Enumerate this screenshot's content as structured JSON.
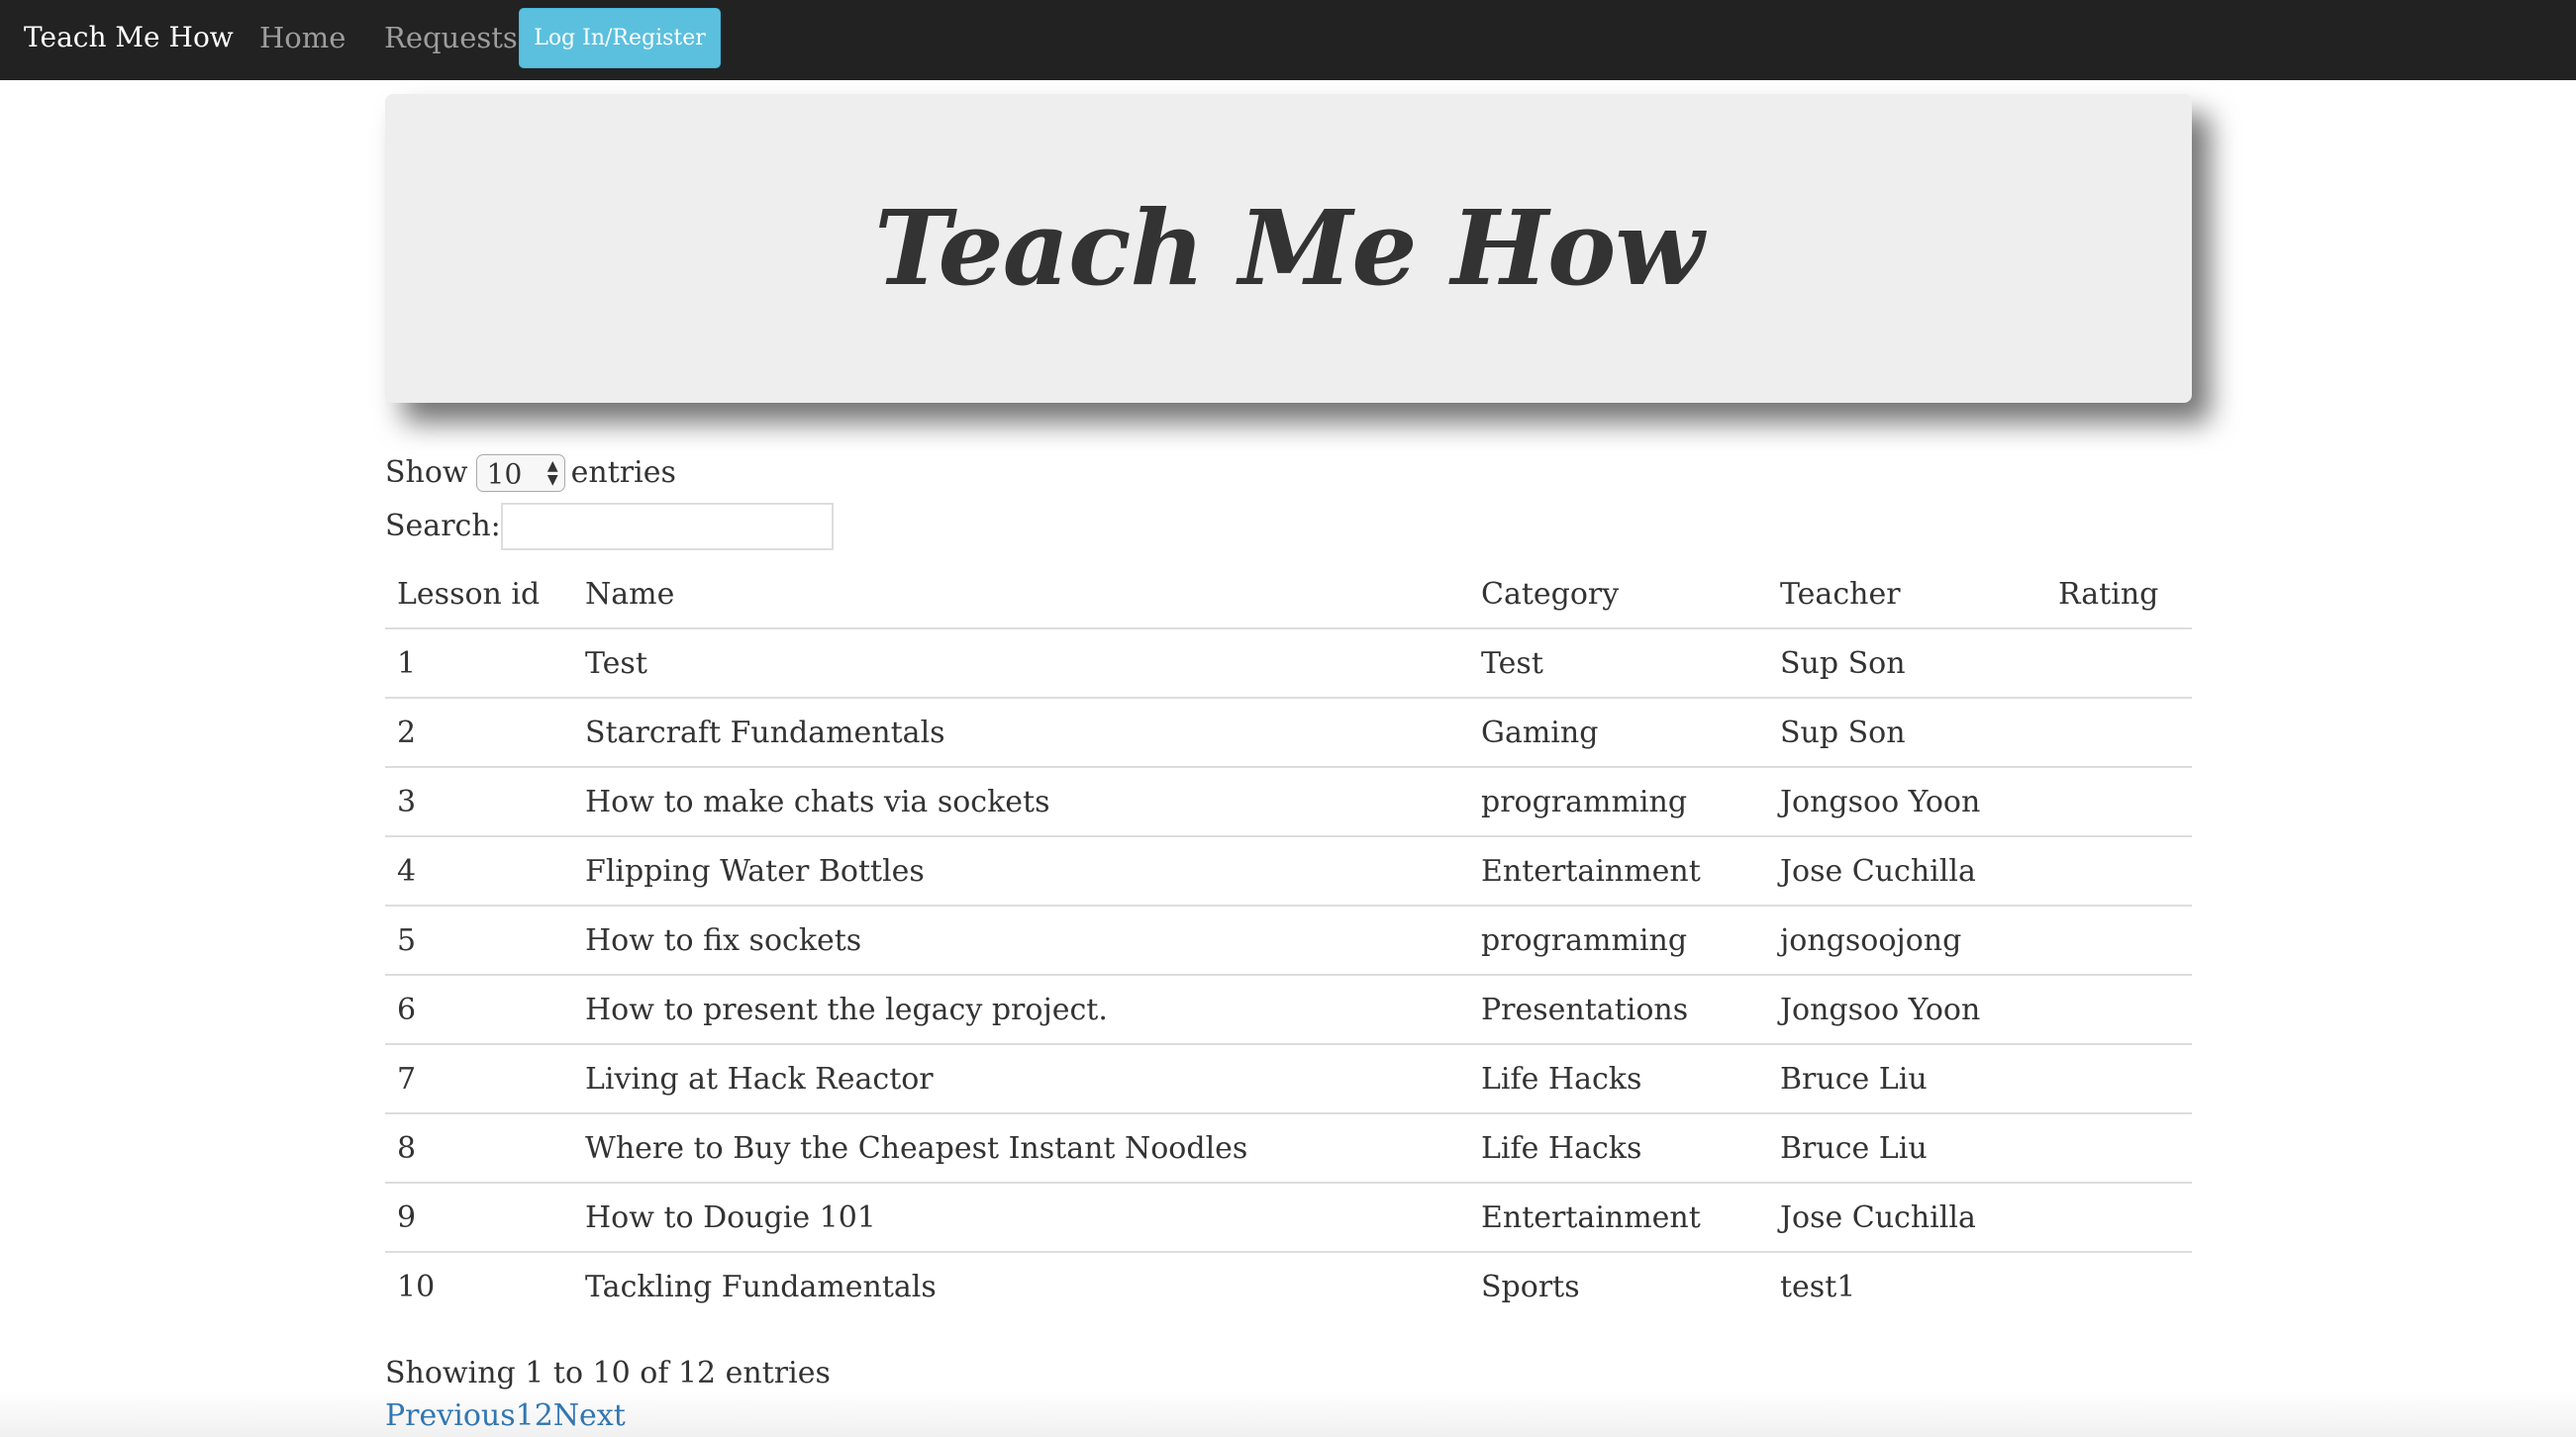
{
  "navbar": {
    "brand": "Teach Me How",
    "links": [
      "Home",
      "Requests"
    ],
    "login_button": "Log In/Register"
  },
  "jumbotron": {
    "title": "Teach Me How"
  },
  "table_controls": {
    "show_label": "Show",
    "page_length": "10",
    "entries_label": "entries",
    "search_label": "Search:",
    "search_value": ""
  },
  "table": {
    "columns": [
      "Lesson id",
      "Name",
      "Category",
      "Teacher",
      "Rating"
    ],
    "rows": [
      {
        "id": "1",
        "name": "Test",
        "category": "Test",
        "teacher": "Sup Son",
        "rating": ""
      },
      {
        "id": "2",
        "name": "Starcraft Fundamentals",
        "category": "Gaming",
        "teacher": "Sup Son",
        "rating": ""
      },
      {
        "id": "3",
        "name": "How to make chats via sockets",
        "category": "programming",
        "teacher": "Jongsoo Yoon",
        "rating": ""
      },
      {
        "id": "4",
        "name": "Flipping Water Bottles",
        "category": "Entertainment",
        "teacher": "Jose Cuchilla",
        "rating": ""
      },
      {
        "id": "5",
        "name": "How to fix sockets",
        "category": "programming",
        "teacher": "jongsoojong",
        "rating": ""
      },
      {
        "id": "6",
        "name": "How to present the legacy project.",
        "category": "Presentations",
        "teacher": "Jongsoo Yoon",
        "rating": ""
      },
      {
        "id": "7",
        "name": "Living at Hack Reactor",
        "category": "Life Hacks",
        "teacher": "Bruce Liu",
        "rating": ""
      },
      {
        "id": "8",
        "name": "Where to Buy the Cheapest Instant Noodles",
        "category": "Life Hacks",
        "teacher": "Bruce Liu",
        "rating": ""
      },
      {
        "id": "9",
        "name": "How to Dougie 101",
        "category": "Entertainment",
        "teacher": "Jose Cuchilla",
        "rating": ""
      },
      {
        "id": "10",
        "name": "Tackling Fundamentals",
        "category": "Sports",
        "teacher": "test1",
        "rating": ""
      }
    ]
  },
  "footer": {
    "info": "Showing 1 to 10 of 12 entries",
    "pagination": {
      "previous": "Previous",
      "pages": [
        "1",
        "2"
      ],
      "next": "Next"
    }
  },
  "colors": {
    "navbar_bg": "#222222",
    "login_button_bg": "#5bc0de",
    "jumbotron_bg": "#eeeeee",
    "link_color": "#337ab7"
  }
}
